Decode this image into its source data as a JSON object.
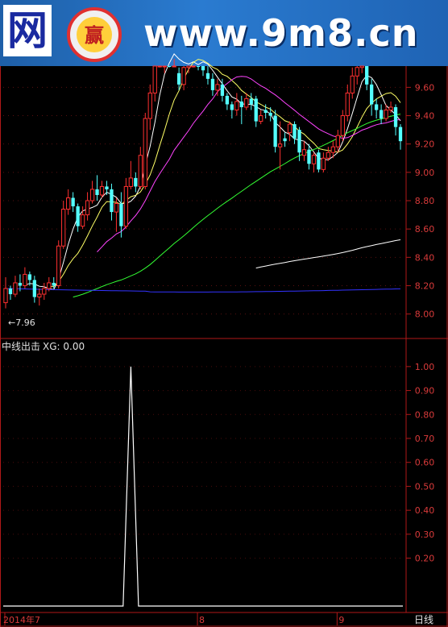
{
  "banner": {
    "logo_char": "网",
    "badge_char": "赢",
    "url": "www.9m8.cn"
  },
  "colors": {
    "up": "#ff3030",
    "down": "#54ffff",
    "ma5": "#ffffff",
    "ma10": "#ffff66",
    "ma20": "#ff44ff",
    "ma60": "#33ff33",
    "ma120": "#ffffff",
    "ma250": "#3333ff",
    "frame": "#b01818",
    "axis_text": "#d83a3a",
    "label_text": "#e0e0e0"
  },
  "main_panel": {
    "low_marker": "←7.96"
  },
  "indicator_panel": {
    "title": "中线出击",
    "value_label": "XG: 0.00"
  },
  "bottom_axis": {
    "period_label": "日线"
  },
  "chart_data": [
    {
      "type": "candlestick",
      "ylim": [
        7.85,
        9.75
      ],
      "y_ticks": [
        "8.00",
        "8.20",
        "8.40",
        "8.60",
        "8.80",
        "9.00",
        "9.20",
        "9.40",
        "9.60"
      ],
      "x_ticks": [
        {
          "label": "2014年7",
          "index": 0
        },
        {
          "label": "8",
          "index": 40
        },
        {
          "label": "9",
          "index": 69
        }
      ],
      "candles": [
        [
          8.08,
          8.18,
          8.26,
          8.04
        ],
        [
          8.18,
          8.14,
          8.2,
          8.1
        ],
        [
          8.14,
          8.22,
          8.27,
          8.12
        ],
        [
          8.22,
          8.2,
          8.28,
          8.16
        ],
        [
          8.2,
          8.28,
          8.33,
          8.18
        ],
        [
          8.28,
          8.24,
          8.3,
          8.2
        ],
        [
          8.24,
          8.12,
          8.27,
          8.08
        ],
        [
          8.12,
          8.14,
          8.18,
          8.06
        ],
        [
          8.14,
          8.18,
          8.22,
          8.1
        ],
        [
          8.18,
          8.22,
          8.26,
          8.16
        ],
        [
          8.22,
          8.2,
          8.26,
          8.18
        ],
        [
          8.2,
          8.48,
          8.52,
          8.18
        ],
        [
          8.48,
          8.74,
          8.8,
          8.46
        ],
        [
          8.74,
          8.82,
          8.88,
          8.7
        ],
        [
          8.82,
          8.76,
          8.86,
          8.72
        ],
        [
          8.76,
          8.62,
          8.78,
          8.58
        ],
        [
          8.62,
          8.7,
          8.76,
          8.6
        ],
        [
          8.7,
          8.8,
          8.86,
          8.66
        ],
        [
          8.8,
          8.88,
          8.94,
          8.78
        ],
        [
          8.88,
          8.84,
          8.98,
          8.8
        ],
        [
          8.84,
          8.9,
          8.94,
          8.82
        ],
        [
          8.9,
          8.88,
          8.94,
          8.84
        ],
        [
          8.88,
          8.72,
          8.92,
          8.66
        ],
        [
          8.72,
          8.78,
          8.82,
          8.58
        ],
        [
          8.78,
          8.62,
          8.86,
          8.54
        ],
        [
          8.62,
          8.9,
          8.96,
          8.6
        ],
        [
          8.9,
          8.96,
          9.08,
          8.88
        ],
        [
          8.96,
          8.9,
          9.0,
          8.86
        ],
        [
          8.9,
          9.12,
          9.18,
          8.88
        ],
        [
          8.9,
          9.38,
          9.42,
          8.88
        ],
        [
          9.38,
          9.56,
          9.62,
          9.3
        ],
        [
          9.56,
          9.8,
          9.85,
          9.5
        ],
        [
          9.8,
          9.86,
          9.92,
          9.74
        ],
        [
          9.8,
          9.86,
          9.9,
          9.7
        ],
        [
          9.86,
          9.78,
          9.9,
          9.74
        ],
        [
          9.84,
          9.88,
          9.92,
          9.8
        ],
        [
          9.7,
          9.62,
          9.74,
          9.58
        ],
        [
          9.62,
          9.74,
          9.78,
          9.58
        ],
        [
          9.74,
          9.8,
          9.9,
          9.7
        ],
        [
          9.8,
          9.86,
          9.96,
          9.74
        ],
        [
          9.86,
          9.78,
          9.88,
          9.72
        ],
        [
          9.78,
          9.72,
          9.84,
          9.68
        ],
        [
          9.7,
          9.66,
          9.76,
          9.62
        ],
        [
          9.66,
          9.58,
          9.7,
          9.54
        ],
        [
          9.58,
          9.62,
          9.66,
          9.54
        ],
        [
          9.62,
          9.54,
          9.66,
          9.5
        ],
        [
          9.54,
          9.48,
          9.56,
          9.44
        ],
        [
          9.48,
          9.44,
          9.5,
          9.38
        ],
        [
          9.44,
          9.5,
          9.56,
          9.4
        ],
        [
          9.5,
          9.46,
          9.54,
          9.34
        ],
        [
          9.46,
          9.52,
          9.56,
          9.44
        ],
        [
          9.52,
          9.48,
          9.56,
          9.44
        ],
        [
          9.52,
          9.36,
          9.54,
          9.32
        ],
        [
          9.36,
          9.4,
          9.44,
          9.34
        ],
        [
          9.44,
          9.42,
          9.48,
          9.38
        ],
        [
          9.42,
          9.4,
          9.46,
          9.36
        ],
        [
          9.4,
          9.18,
          9.44,
          9.14
        ],
        [
          9.18,
          9.2,
          9.36,
          9.02
        ],
        [
          9.24,
          9.22,
          9.28,
          9.18
        ],
        [
          9.28,
          9.34,
          9.36,
          9.22
        ],
        [
          9.34,
          9.24,
          9.36,
          9.2
        ],
        [
          9.3,
          9.14,
          9.32,
          9.08
        ],
        [
          9.12,
          9.16,
          9.22,
          9.08
        ],
        [
          9.16,
          9.06,
          9.2,
          9.02
        ],
        [
          9.06,
          9.12,
          9.14,
          9.0
        ],
        [
          9.14,
          9.02,
          9.16,
          9.0
        ],
        [
          9.02,
          9.1,
          9.14,
          9.0
        ],
        [
          9.1,
          9.14,
          9.18,
          9.08
        ],
        [
          9.14,
          9.18,
          9.22,
          9.1
        ],
        [
          9.18,
          9.26,
          9.3,
          9.14
        ],
        [
          9.26,
          9.4,
          9.44,
          9.22
        ],
        [
          9.4,
          9.56,
          9.62,
          9.36
        ],
        [
          9.56,
          9.68,
          9.74,
          9.52
        ],
        [
          9.68,
          9.74,
          9.8,
          9.62
        ],
        [
          9.74,
          9.82,
          9.86,
          9.7
        ],
        [
          9.82,
          9.62,
          9.84,
          9.58
        ],
        [
          9.62,
          9.48,
          9.66,
          9.4
        ],
        [
          9.48,
          9.44,
          9.52,
          9.38
        ],
        [
          9.44,
          9.38,
          9.48,
          9.34
        ],
        [
          9.38,
          9.44,
          9.48,
          9.36
        ],
        [
          9.44,
          9.46,
          9.5,
          9.42
        ],
        [
          9.46,
          9.32,
          9.48,
          9.26
        ],
        [
          9.32,
          9.22,
          9.34,
          9.16
        ]
      ]
    },
    {
      "type": "line",
      "title": "中线出击",
      "ylim": [
        0,
        1.05
      ],
      "y_ticks": [
        "0.20",
        "0.30",
        "0.40",
        "0.50",
        "0.60",
        "0.70",
        "0.80",
        "0.90",
        "1.00"
      ],
      "series": [
        {
          "name": "XG",
          "signal_index": 26,
          "signal_value": 1.0,
          "base_value": 0.0
        }
      ]
    }
  ]
}
